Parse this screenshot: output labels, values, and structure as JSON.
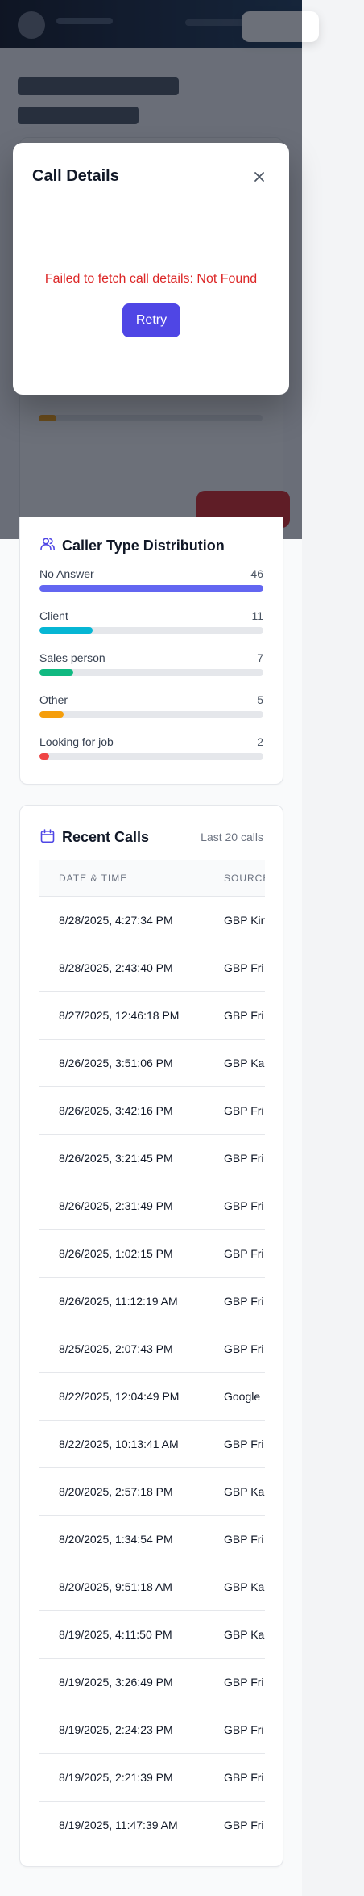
{
  "modal": {
    "title": "Call Details",
    "error_message": "Failed to fetch call details: Not Found",
    "retry_label": "Retry"
  },
  "caller_distribution": {
    "title": "Caller Type Distribution",
    "items": [
      {
        "label": "No Answer",
        "count": "46",
        "fraction": 1.0,
        "color": "#6366f1"
      },
      {
        "label": "Client",
        "count": "11",
        "fraction": 0.239,
        "color": "#06b6d4"
      },
      {
        "label": "Sales person",
        "count": "7",
        "fraction": 0.152,
        "color": "#10b981"
      },
      {
        "label": "Other",
        "count": "5",
        "fraction": 0.109,
        "color": "#f59e0b"
      },
      {
        "label": "Looking for job",
        "count": "2",
        "fraction": 0.043,
        "color": "#ef4444"
      }
    ]
  },
  "recent_calls": {
    "title": "Recent Calls",
    "subtitle": "Last 20 calls",
    "columns": [
      "DATE & TIME",
      "SOURCE"
    ],
    "rows": [
      {
        "datetime": "8/28/2025, 4:27:34 PM",
        "source": "GBP Kin"
      },
      {
        "datetime": "8/28/2025, 2:43:40 PM",
        "source": "GBP Fri"
      },
      {
        "datetime": "8/27/2025, 12:46:18 PM",
        "source": "GBP Fri"
      },
      {
        "datetime": "8/26/2025, 3:51:06 PM",
        "source": "GBP Ka"
      },
      {
        "datetime": "8/26/2025, 3:42:16 PM",
        "source": "GBP Fri"
      },
      {
        "datetime": "8/26/2025, 3:21:45 PM",
        "source": "GBP Fri"
      },
      {
        "datetime": "8/26/2025, 2:31:49 PM",
        "source": "GBP Fri"
      },
      {
        "datetime": "8/26/2025, 1:02:15 PM",
        "source": "GBP Fri"
      },
      {
        "datetime": "8/26/2025, 11:12:19 AM",
        "source": "GBP Fri"
      },
      {
        "datetime": "8/25/2025, 2:07:43 PM",
        "source": "GBP Fri"
      },
      {
        "datetime": "8/22/2025, 12:04:49 PM",
        "source": "Google"
      },
      {
        "datetime": "8/22/2025, 10:13:41 AM",
        "source": "GBP Fri"
      },
      {
        "datetime": "8/20/2025, 2:57:18 PM",
        "source": "GBP Ka"
      },
      {
        "datetime": "8/20/2025, 1:34:54 PM",
        "source": "GBP Fri"
      },
      {
        "datetime": "8/20/2025, 9:51:18 AM",
        "source": "GBP Ka"
      },
      {
        "datetime": "8/19/2025, 4:11:50 PM",
        "source": "GBP Ka"
      },
      {
        "datetime": "8/19/2025, 3:26:49 PM",
        "source": "GBP Fri"
      },
      {
        "datetime": "8/19/2025, 2:24:23 PM",
        "source": "GBP Fri"
      },
      {
        "datetime": "8/19/2025, 2:21:39 PM",
        "source": "GBP Fri"
      },
      {
        "datetime": "8/19/2025, 11:47:39 AM",
        "source": "GBP Fri"
      }
    ]
  },
  "colors": {
    "accent": "#4f46e5",
    "error": "#dc2626"
  }
}
